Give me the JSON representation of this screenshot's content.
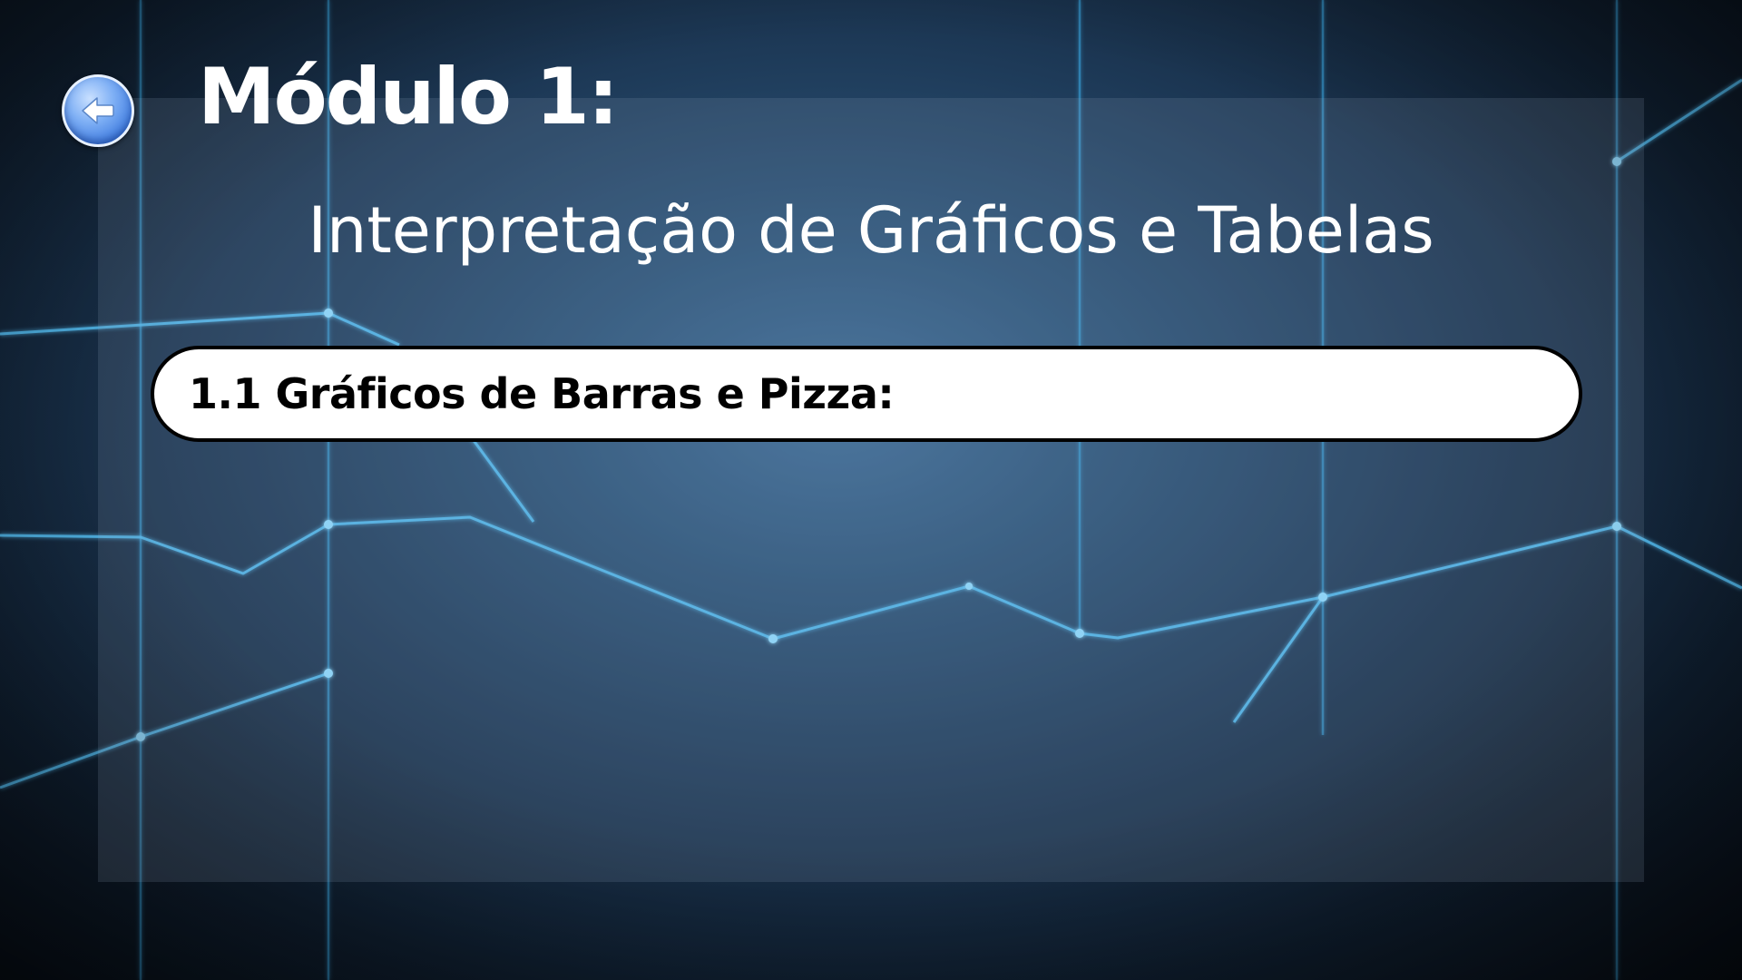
{
  "module": {
    "title": "Módulo 1:",
    "subtitle": "Interpretação de Gráficos e Tabelas"
  },
  "section": {
    "label": "1.1 Gráficos de Barras e Pizza:"
  },
  "icons": {
    "back": "back-arrow-icon"
  },
  "colors": {
    "line_accent": "#4fb8f0",
    "back_button": "#4a86e8",
    "panel_text": "#ffffff",
    "section_bar_bg": "#ffffff",
    "section_bar_border": "#000000"
  }
}
